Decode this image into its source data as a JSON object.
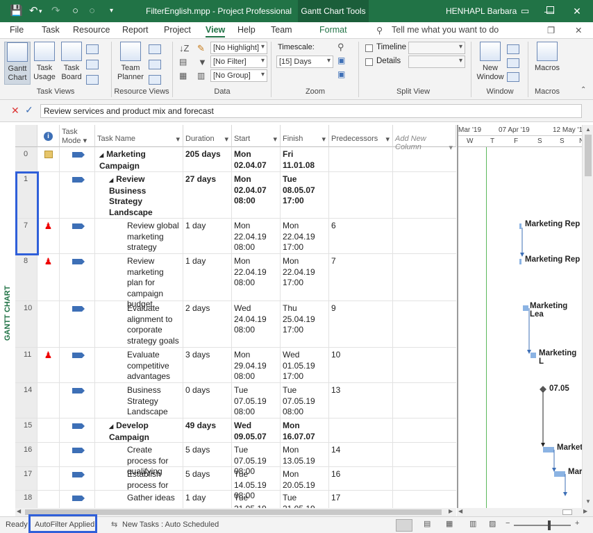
{
  "titlebar": {
    "file": "FilterEnglish.mpp  -  Project Professional",
    "context_tab": "Gantt Chart Tools",
    "user": "HENHAPL Barbara"
  },
  "menu": {
    "file": "File",
    "task": "Task",
    "resource": "Resource",
    "report": "Report",
    "project": "Project",
    "view": "View",
    "help": "Help",
    "team": "Team",
    "format": "Format",
    "tell": "Tell me what you want to do"
  },
  "ribbon": {
    "task_views": {
      "gantt": "Gantt Chart",
      "task_usage": "Task Usage",
      "task_board": "Task Board",
      "label": "Task Views"
    },
    "resource_views": {
      "team_planner": "Team Planner",
      "label": "Resource Views"
    },
    "data": {
      "highlight": "[No Highlight]",
      "filter": "[No Filter]",
      "group": "[No Group]",
      "label": "Data"
    },
    "zoom": {
      "timescale_label": "Timescale:",
      "timescale": "[15] Days",
      "label": "Zoom"
    },
    "split": {
      "timeline": "Timeline",
      "details": "Details",
      "label": "Split View"
    },
    "window": {
      "new_window": "New Window",
      "label": "Window"
    },
    "macros": {
      "macros": "Macros",
      "label": "Macros"
    }
  },
  "entry": {
    "value": "Review services and product mix and forecast"
  },
  "side_label": "GANTT CHART",
  "columns": {
    "mode": "Task Mode",
    "name": "Task Name",
    "duration": "Duration",
    "start": "Start",
    "finish": "Finish",
    "pred": "Predecessors",
    "add": "Add New Column"
  },
  "timescale": {
    "d1": "Mar '19",
    "d2": "07 Apr '19",
    "d3": "12 May '1",
    "w": "W",
    "t": "T",
    "f": "F",
    "s": "S",
    "s2": "S",
    "n": "N"
  },
  "rows": [
    {
      "id": "0",
      "name": "Marketing Campaign",
      "dur": "205 days",
      "start": "Mon 02.04.07",
      "finish": "Fri 11.01.08",
      "pred": ""
    },
    {
      "id": "1",
      "name": "Review Business Strategy Landscape",
      "dur": "27 days",
      "start": "Mon 02.04.07 08:00",
      "finish": "Tue 08.05.07 17:00",
      "pred": ""
    },
    {
      "id": "7",
      "name": "Review global marketing strategy",
      "dur": "1 day",
      "start": "Mon 22.04.19 08:00",
      "finish": "Mon 22.04.19 17:00",
      "pred": "6"
    },
    {
      "id": "8",
      "name": "Review marketing plan for campaign budget",
      "dur": "1 day",
      "start": "Mon 22.04.19 08:00",
      "finish": "Mon 22.04.19 17:00",
      "pred": "7"
    },
    {
      "id": "10",
      "name": "Evaluate alignment to corporate strategy goals",
      "dur": "2 days",
      "start": "Wed 24.04.19 08:00",
      "finish": "Thu 25.04.19 17:00",
      "pred": "9"
    },
    {
      "id": "11",
      "name": "Evaluate competitive advantages",
      "dur": "3 days",
      "start": "Mon 29.04.19 08:00",
      "finish": "Wed 01.05.19 17:00",
      "pred": "10"
    },
    {
      "id": "14",
      "name": "Business Strategy Landscape",
      "dur": "0 days",
      "start": "Tue 07.05.19 08:00",
      "finish": "Tue 07.05.19 08:00",
      "pred": "13"
    },
    {
      "id": "15",
      "name": "Develop Campaign",
      "dur": "49 days",
      "start": "Wed 09.05.07",
      "finish": "Mon 16.07.07",
      "pred": ""
    },
    {
      "id": "16",
      "name": "Create process for qualifying",
      "dur": "5 days",
      "start": "Tue 07.05.19 08:00",
      "finish": "Mon 13.05.19",
      "pred": "14"
    },
    {
      "id": "17",
      "name": "Establish process for",
      "dur": "5 days",
      "start": "Tue 14.05.19 08:00",
      "finish": "Mon 20.05.19",
      "pred": "16"
    },
    {
      "id": "18",
      "name": "Gather ideas",
      "dur": "1 day",
      "start": "Tue 21.05.19",
      "finish": "Tue 21.05.19",
      "pred": "17"
    }
  ],
  "chart_labels": {
    "r7": "Marketing Rep",
    "r8": "Marketing Rep",
    "r10": "Marketing Lea",
    "r11": "Marketing L",
    "r14": "07.05",
    "r16": "Market",
    "r17": "Mar"
  },
  "status": {
    "ready": "Ready",
    "autofilter": "AutoFilter Applied",
    "new_tasks": "New Tasks : Auto Scheduled"
  }
}
